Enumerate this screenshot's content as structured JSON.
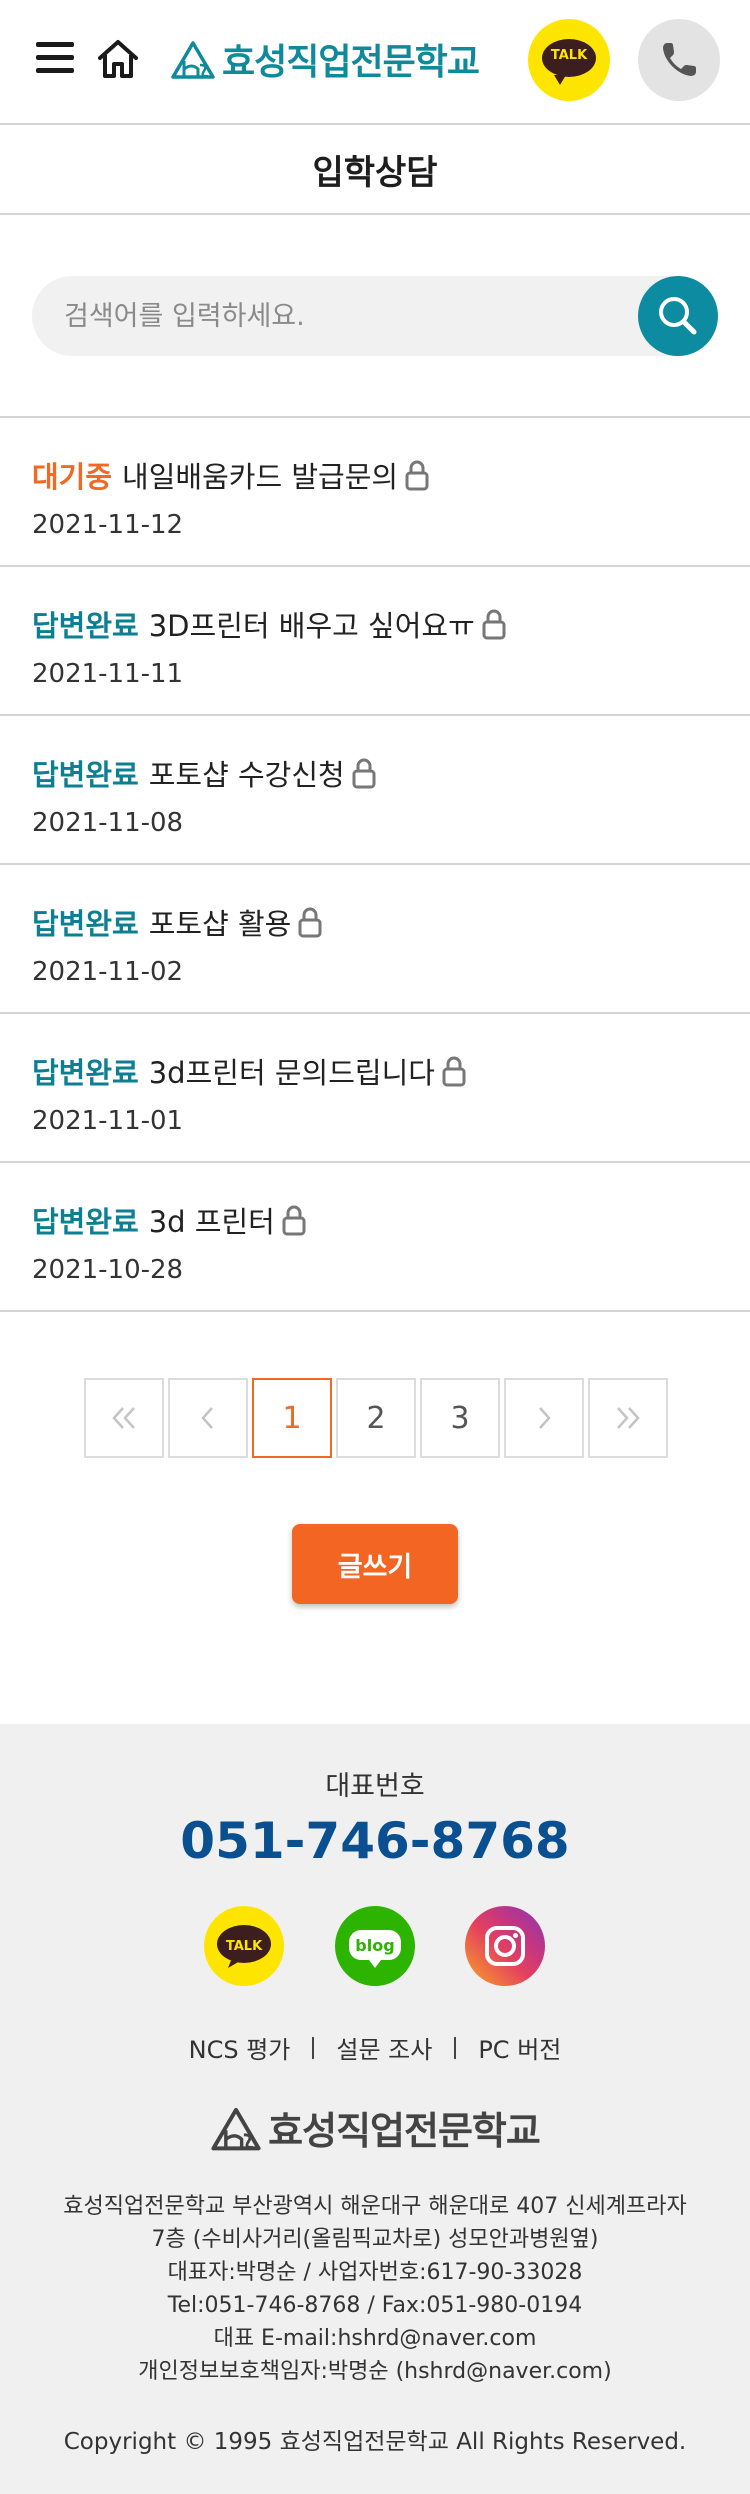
{
  "header": {
    "logo_text": "효성직업전문학교",
    "talk_label": "TALK"
  },
  "page": {
    "title": "입학상담"
  },
  "search": {
    "placeholder": "검색어를 입력하세요."
  },
  "posts": [
    {
      "status": "대기중",
      "subject": "내일배움카드 발급문의",
      "date": "2021-11-12"
    },
    {
      "status": "답변완료",
      "subject": "3D프린터 배우고 싶어요ㅠ",
      "date": "2021-11-11"
    },
    {
      "status": "답변완료",
      "subject": "포토샵 수강신청",
      "date": "2021-11-08"
    },
    {
      "status": "답변완료",
      "subject": "포토샵 활용",
      "date": "2021-11-02"
    },
    {
      "status": "답변완료",
      "subject": "3d프린터 문의드립니다",
      "date": "2021-11-01"
    },
    {
      "status": "답변완료",
      "subject": "3d 프린터",
      "date": "2021-10-28"
    }
  ],
  "pagination": {
    "pages": [
      "1",
      "2",
      "3"
    ],
    "current": "1"
  },
  "write_button": "글쓰기",
  "footer": {
    "rep_label": "대표번호",
    "rep_phone": "051-746-8768",
    "social": {
      "kakao": "TALK",
      "blog": "blog"
    },
    "links": [
      "NCS 평가",
      "설문 조사",
      "PC 버전"
    ],
    "logo_text": "효성직업전문학교",
    "info": [
      "효성직업전문학교 부산광역시 해운대구 해운대로 407 신세계프라자",
      "7층 (수비사거리(올림픽교차로) 성모안과병원옆)",
      "대표자:박명순 / 사업자번호:617-90-33028",
      "Tel:051-746-8768 / Fax:051-980-0194",
      "대표 E-mail:hshrd@naver.com",
      "개인정보보호책임자:박명순 (hshrd@naver.com)"
    ],
    "copyright": "Copyright © 1995 효성직업전문학교 All Rights Reserved."
  },
  "colors": {
    "brand": "#0f8a9b",
    "waiting": "#f06a24",
    "done": "#0d7f93",
    "accent_button": "#f26522",
    "phone": "#0a4f8f"
  },
  "icons": {
    "menu": "hamburger-icon",
    "home": "home-icon",
    "talk": "kakaotalk-icon",
    "call": "phone-icon",
    "search": "search-icon",
    "lock": "lock-icon"
  }
}
